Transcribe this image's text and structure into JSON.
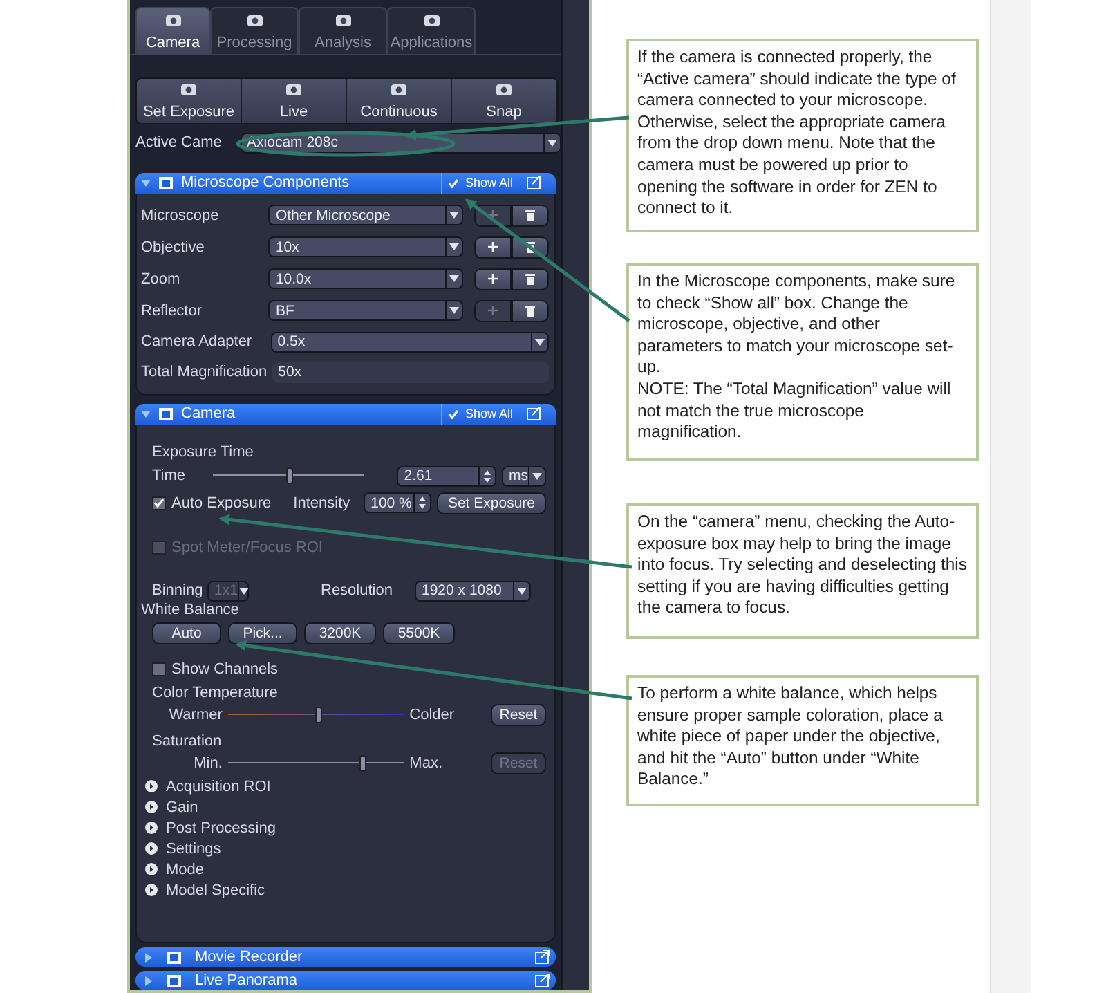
{
  "tabs": [
    {
      "label": "Camera",
      "selected": true
    },
    {
      "label": "Processing",
      "selected": false
    },
    {
      "label": "Analysis",
      "selected": false
    },
    {
      "label": "Applications",
      "selected": false
    }
  ],
  "actions": [
    {
      "label": "Set Exposure"
    },
    {
      "label": "Live"
    },
    {
      "label": "Continuous"
    },
    {
      "label": "Snap"
    }
  ],
  "active_camera": {
    "label": "Active Came",
    "value": "Axiocam 208c"
  },
  "microscope_components": {
    "title": "Microscope Components",
    "show_all": "Show All",
    "show_all_checked": true,
    "rows": [
      {
        "kind": "dropdown_buttons",
        "label": "Microscope",
        "value": "Other Microscope",
        "add_disabled": true
      },
      {
        "kind": "dropdown_buttons",
        "label": "Objective",
        "value": "10x",
        "add_disabled": false
      },
      {
        "kind": "dropdown_buttons",
        "label": "Zoom",
        "value": "10.0x",
        "add_disabled": false
      },
      {
        "kind": "dropdown_buttons",
        "label": "Reflector",
        "value": "BF",
        "add_disabled": true
      },
      {
        "kind": "dropdown",
        "label": "Camera Adapter",
        "value": "0.5x"
      },
      {
        "kind": "readout",
        "label": "Total Magnification",
        "value": "50x"
      }
    ]
  },
  "camera": {
    "title": "Camera",
    "show_all": "Show All",
    "show_all_checked": true,
    "exposure_title": "Exposure Time",
    "time_label": "Time",
    "time_slider": {
      "level": 0.5
    },
    "time_value": "2.61",
    "time_unit": "ms",
    "auto_exposure": {
      "label": "Auto Exposure",
      "checked": true
    },
    "intensity_label": "Intensity",
    "intensity_value": "100 %",
    "set_exposure": "Set Exposure",
    "spot_meter": {
      "label": "Spot Meter/Focus ROI",
      "checked": false,
      "disabled": true
    },
    "binning": {
      "label": "Binning",
      "value": "1x1",
      "disabled": true
    },
    "resolution": {
      "label": "Resolution",
      "value": "1920 x 1080"
    },
    "white_balance": {
      "title": "White Balance",
      "buttons": [
        "Auto",
        "Pick...",
        "3200K",
        "5500K"
      ]
    },
    "show_channels": {
      "label": "Show Channels",
      "checked": false
    },
    "sliders": [
      {
        "title": "Color Temperature",
        "min": "Warmer",
        "max": "Colder",
        "level": 0.5,
        "reset": "Reset",
        "reset_disabled": false,
        "kind": "color"
      },
      {
        "title": "Saturation",
        "min": "Min.",
        "max": "Max.",
        "level": 0.75,
        "reset": "Reset",
        "reset_disabled": true,
        "kind": "plain"
      }
    ],
    "sections": [
      "Acquisition ROI",
      "Gain",
      "Post Processing",
      "Settings",
      "Mode",
      "Model Specific"
    ]
  },
  "bottom_panels": [
    {
      "title": "Movie Recorder"
    },
    {
      "title": "Live Panorama"
    }
  ],
  "callouts": [
    {
      "paragraphs": [
        "If the camera is connected properly, the “Active camera” should indicate the type of camera connected to your microscope. Otherwise, select the appropriate camera from the drop down menu. Note that the camera must be powered up prior to opening the software in order for ZEN to connect to it."
      ]
    },
    {
      "paragraphs": [
        "In the Microscope components, make sure to check “Show all” box. Change the microscope, objective, and other parameters to match your microscope set-up.",
        "NOTE: The “Total Magnification” value will not match the true microscope magnification."
      ]
    },
    {
      "paragraphs": [
        "On the “camera” menu, checking the Auto-exposure box may help to bring the image into focus. Try selecting and deselecting this setting if you are having difficulties getting the camera to focus."
      ]
    },
    {
      "paragraphs": [
        "To perform a white balance, which helps ensure proper sample coloration, place a white piece of paper under the objective, and hit the “Auto” button under “White Balance.”"
      ]
    }
  ]
}
